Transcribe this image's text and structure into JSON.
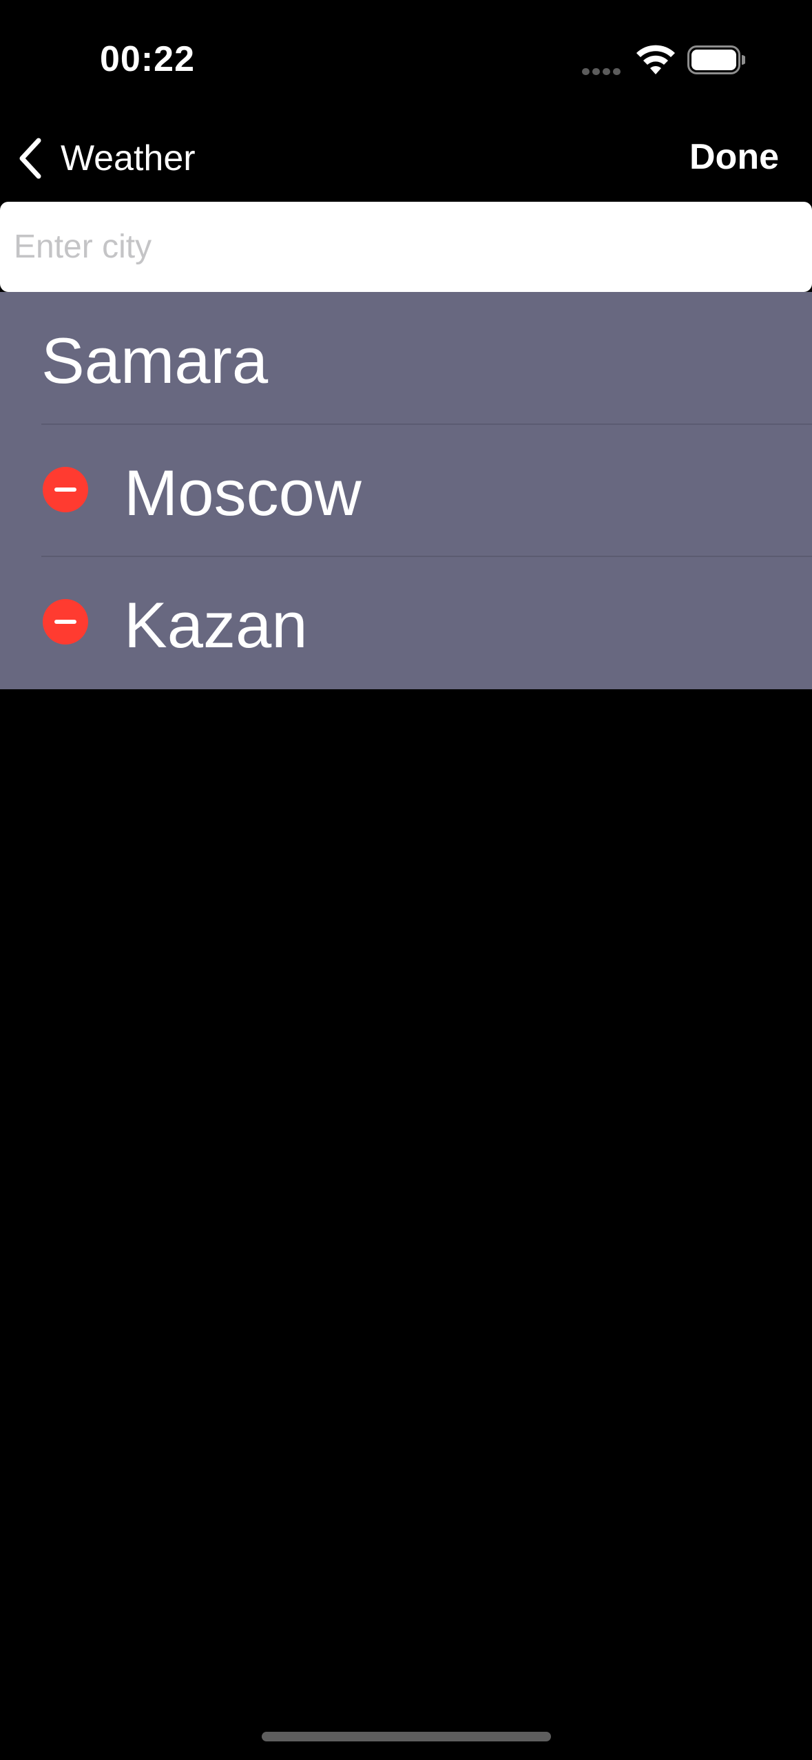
{
  "status_bar": {
    "time": "00:22",
    "icons": [
      "signal-icon",
      "wifi-icon",
      "battery-icon"
    ]
  },
  "nav": {
    "back_label": "Weather",
    "back_icon": "chevron-left-icon",
    "done_label": "Done"
  },
  "search": {
    "placeholder": "Enter city",
    "value": ""
  },
  "cities": [
    {
      "name": "Samara",
      "deletable": false
    },
    {
      "name": "Moscow",
      "deletable": true
    },
    {
      "name": "Kazan",
      "deletable": true
    }
  ],
  "colors": {
    "background": "#000000",
    "list_background": "#686880",
    "delete_red": "#ff3b30",
    "text": "#ffffff",
    "placeholder": "#c4c4c6"
  }
}
